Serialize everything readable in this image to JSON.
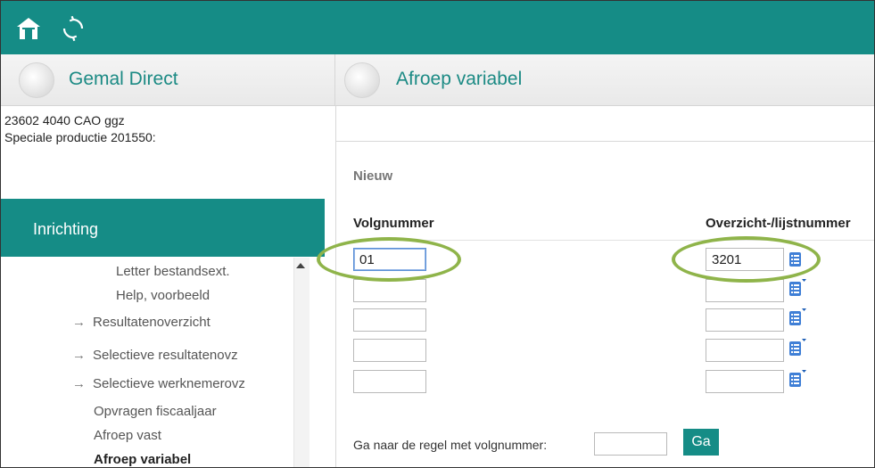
{
  "topbar": {
    "home_icon": "home-icon",
    "refresh_icon": "refresh-icon"
  },
  "header": {
    "left_title": "Gemal Direct",
    "right_title": "Afroep variabel"
  },
  "client": {
    "line1": "23602 4040 CAO ggz",
    "line2": "Speciale productie  201550:"
  },
  "nav": {
    "section_title": "Inrichting",
    "items": [
      {
        "label": "Letter bestandsext.",
        "arrow": ""
      },
      {
        "label": "Help, voorbeeld",
        "arrow": ""
      },
      {
        "label": "Resultatenoverzicht",
        "arrow": "→"
      },
      {
        "label": "Selectieve resultatenovz",
        "arrow": "→"
      },
      {
        "label": "Selectieve werknemerovz",
        "arrow": "→"
      },
      {
        "label": "Opvragen fiscaaljaar",
        "arrow": ""
      },
      {
        "label": "Afroep vast",
        "arrow": ""
      },
      {
        "label": "Afroep variabel",
        "arrow": ""
      }
    ]
  },
  "form": {
    "section_label": "Nieuw",
    "col_volgnummer": "Volgnummer",
    "col_lijstnummer": "Overzicht-/lijstnummer",
    "rows": [
      {
        "volgnummer": "01",
        "lijstnummer": "3201"
      },
      {
        "volgnummer": "",
        "lijstnummer": ""
      },
      {
        "volgnummer": "",
        "lijstnummer": ""
      },
      {
        "volgnummer": "",
        "lijstnummer": ""
      },
      {
        "volgnummer": "",
        "lijstnummer": ""
      }
    ],
    "goto_label": "Ga naar de regel met volgnummer:",
    "goto_value": "",
    "go_button": "Ga"
  },
  "colors": {
    "accent": "#158c86",
    "highlight": "#8fb44a"
  }
}
